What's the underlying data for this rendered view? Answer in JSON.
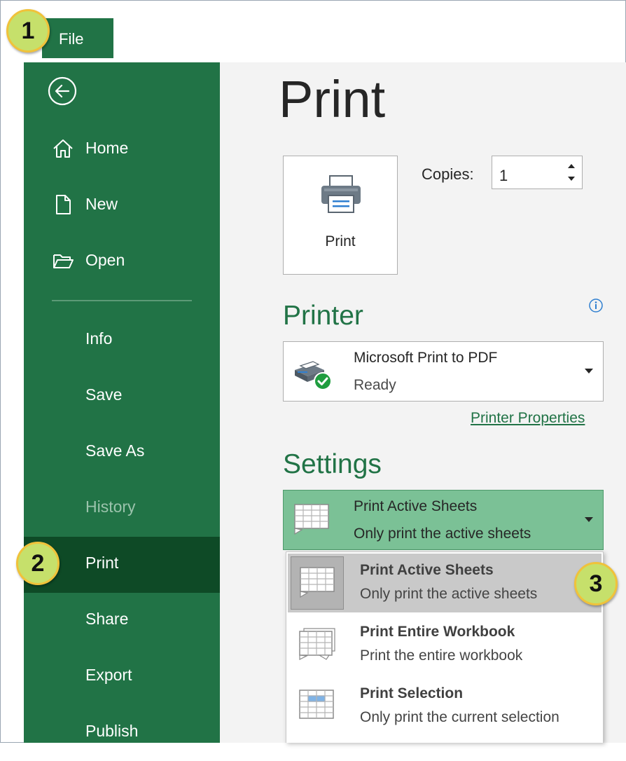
{
  "callouts": [
    "1",
    "2",
    "3"
  ],
  "file_tab": {
    "label": "File"
  },
  "nav": {
    "items": [
      {
        "label": "Home",
        "icon": "home-icon"
      },
      {
        "label": "New",
        "icon": "new-document-icon"
      },
      {
        "label": "Open",
        "icon": "open-folder-icon"
      },
      {
        "label": "Info"
      },
      {
        "label": "Save"
      },
      {
        "label": "Save As"
      },
      {
        "label": "History",
        "state": "disabled"
      },
      {
        "label": "Print",
        "state": "selected"
      },
      {
        "label": "Share"
      },
      {
        "label": "Export"
      },
      {
        "label": "Publish"
      }
    ]
  },
  "print": {
    "title": "Print",
    "button_label": "Print",
    "copies_label": "Copies:",
    "copies_value": "1"
  },
  "printer": {
    "section_title": "Printer",
    "name": "Microsoft Print to PDF",
    "status": "Ready",
    "properties_link": "Printer Properties"
  },
  "settings": {
    "section_title": "Settings",
    "selected_title": "Print Active Sheets",
    "selected_desc": "Only print the active sheets",
    "options": [
      {
        "title": "Print Active Sheets",
        "desc": "Only print the active sheets",
        "highlighted": true
      },
      {
        "title": "Print Entire Workbook",
        "desc": "Print the entire workbook"
      },
      {
        "title": "Print Selection",
        "desc": "Only print the current selection"
      }
    ]
  },
  "colors": {
    "accent": "#217346",
    "nav_active": "#0e4a26",
    "dropdown_selected": "#7bc196",
    "callout_fill": "#c6e06b",
    "callout_ring": "#f0c23a"
  }
}
